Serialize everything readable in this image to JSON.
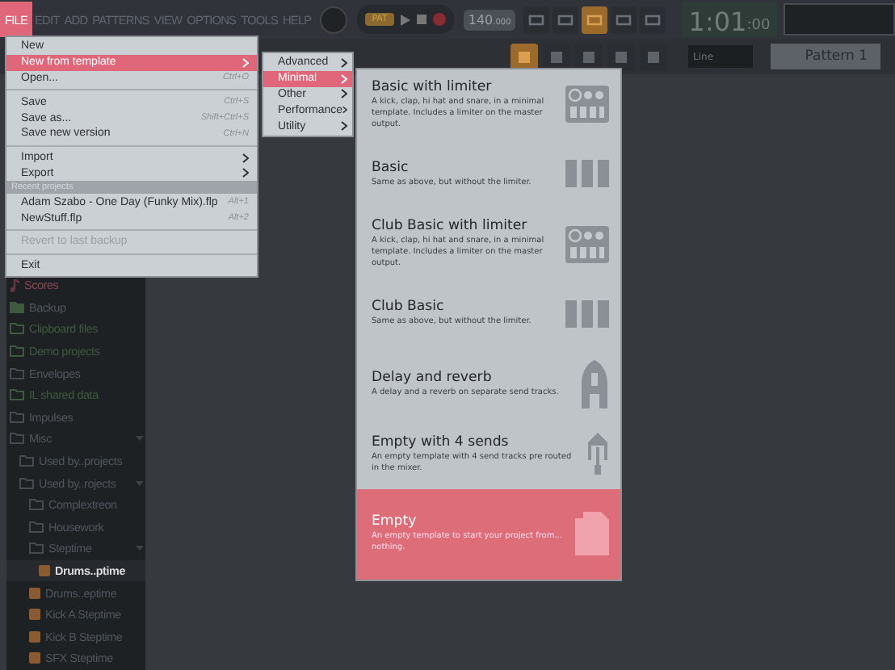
{
  "menu_bar": {
    "items": [
      {
        "label": "FILE",
        "selected": true
      },
      {
        "label": "EDIT",
        "selected": false
      },
      {
        "label": "ADD",
        "selected": false
      },
      {
        "label": "PATTERNS",
        "selected": false
      },
      {
        "label": "VIEW",
        "selected": false
      },
      {
        "label": "OPTIONS",
        "selected": false
      },
      {
        "label": "TOOLS",
        "selected": false
      },
      {
        "label": "HELP",
        "selected": false
      }
    ]
  },
  "transport": {
    "mode": "PAT",
    "tempo": "140",
    "tempo_fraction": ".000",
    "clock": "1:01",
    "clock_ticks": ":00"
  },
  "toolbar": {
    "snap": "Line",
    "pattern": "Pattern 1"
  },
  "browser": {
    "items": [
      {
        "kind": "score",
        "label": "Scores",
        "selected": false,
        "expanded": false
      },
      {
        "kind": "backup",
        "label": "Backup",
        "selected": false,
        "expanded": false
      },
      {
        "kind": "linked",
        "label": "Clipboard files",
        "selected": false,
        "expanded": false
      },
      {
        "kind": "linked",
        "label": "Demo projects",
        "selected": false,
        "expanded": false
      },
      {
        "kind": "folder",
        "label": "Envelopes",
        "selected": false,
        "expanded": false
      },
      {
        "kind": "linked",
        "label": "IL shared data",
        "selected": false,
        "expanded": false
      },
      {
        "kind": "folder",
        "label": "Impulses",
        "selected": false,
        "expanded": false
      },
      {
        "kind": "folder",
        "label": "Misc",
        "selected": false,
        "expanded": true,
        "children": [
          {
            "kind": "folder",
            "label": "Used by..projects",
            "selected": false,
            "expanded": false
          },
          {
            "kind": "folder",
            "label": "Used by..rojects",
            "selected": false,
            "expanded": true,
            "children": [
              {
                "kind": "folder",
                "label": "Complextreon",
                "selected": false,
                "expanded": false
              },
              {
                "kind": "folder",
                "label": "Housework",
                "selected": false,
                "expanded": false
              },
              {
                "kind": "folder",
                "label": "Steptime",
                "selected": false,
                "expanded": true,
                "children": [
                  {
                    "kind": "file",
                    "label": "Drums..ptime",
                    "selected": true,
                    "expanded": false
                  }
                ]
              },
              {
                "kind": "file",
                "label": "Drums..eptime",
                "selected": false,
                "expanded": false
              },
              {
                "kind": "file",
                "label": "Kick A Steptime",
                "selected": false,
                "expanded": false
              },
              {
                "kind": "file",
                "label": "Kick B Steptime",
                "selected": false,
                "expanded": false
              },
              {
                "kind": "file",
                "label": "SFX Steptime",
                "selected": false,
                "expanded": false
              }
            ]
          }
        ]
      }
    ]
  },
  "file_menu": {
    "items": [
      {
        "kind": "item",
        "label": "New",
        "selected": false,
        "disabled": false,
        "submenu": false
      },
      {
        "kind": "item",
        "label": "New from template",
        "selected": true,
        "disabled": false,
        "submenu": true
      },
      {
        "kind": "item",
        "label": "Open...",
        "shortcut": "Ctrl+O",
        "selected": false,
        "disabled": false,
        "submenu": false
      },
      {
        "kind": "separator"
      },
      {
        "kind": "item",
        "label": "Save",
        "shortcut": "Ctrl+S",
        "selected": false,
        "disabled": false,
        "submenu": false
      },
      {
        "kind": "item",
        "label": "Save as...",
        "shortcut": "Shift+Ctrl+S",
        "selected": false,
        "disabled": false,
        "submenu": false
      },
      {
        "kind": "item",
        "label": "Save new version",
        "shortcut": "Ctrl+N",
        "selected": false,
        "disabled": false,
        "submenu": false
      },
      {
        "kind": "separator"
      },
      {
        "kind": "item",
        "label": "Import",
        "selected": false,
        "disabled": false,
        "submenu": true
      },
      {
        "kind": "item",
        "label": "Export",
        "selected": false,
        "disabled": false,
        "submenu": true
      },
      {
        "kind": "header",
        "label": "Recent projects"
      },
      {
        "kind": "item",
        "label": "Adam Szabo - One Day (Funky Mix).flp",
        "shortcut": "Alt+1",
        "selected": false,
        "disabled": false,
        "submenu": false
      },
      {
        "kind": "item",
        "label": "NewStuff.flp",
        "shortcut": "Alt+2",
        "selected": false,
        "disabled": false,
        "submenu": false
      },
      {
        "kind": "separator"
      },
      {
        "kind": "item",
        "label": "Revert to last backup",
        "selected": false,
        "disabled": true,
        "submenu": false
      },
      {
        "kind": "separator"
      },
      {
        "kind": "item",
        "label": "Exit",
        "selected": false,
        "disabled": false,
        "submenu": false
      }
    ]
  },
  "template_categories": [
    {
      "label": "Advanced",
      "selected": false
    },
    {
      "label": "Minimal",
      "selected": true
    },
    {
      "label": "Other",
      "selected": false
    },
    {
      "label": "Performance",
      "selected": false
    },
    {
      "label": "Utility",
      "selected": false
    }
  ],
  "templates": [
    {
      "kind": "limiter",
      "title": "Basic with limiter",
      "description": "A kick, clap, hi hat and snare, in a minimal template. Includes a limiter on the master output.",
      "selected": false
    },
    {
      "kind": "faders",
      "title": "Basic",
      "description": "Same as above, but without the limiter.",
      "selected": false
    },
    {
      "kind": "limiter",
      "title": "Club Basic with limiter",
      "description": "A kick, clap, hi hat and snare, in a minimal template. Includes a limiter on the master output.",
      "selected": false
    },
    {
      "kind": "faders",
      "title": "Club Basic",
      "description": "Same as above, but without the limiter.",
      "selected": false
    },
    {
      "kind": "delay",
      "title": "Delay and reverb",
      "description": "A delay and a reverb on separate send tracks.",
      "selected": false
    },
    {
      "kind": "sends",
      "title": "Empty with 4 sends",
      "description": "An empty template with 4 send tracks pre routed in the mixer.",
      "selected": false
    },
    {
      "kind": "page",
      "title": "Empty",
      "description": "An empty template to start your project from... nothing.",
      "selected": true
    }
  ]
}
